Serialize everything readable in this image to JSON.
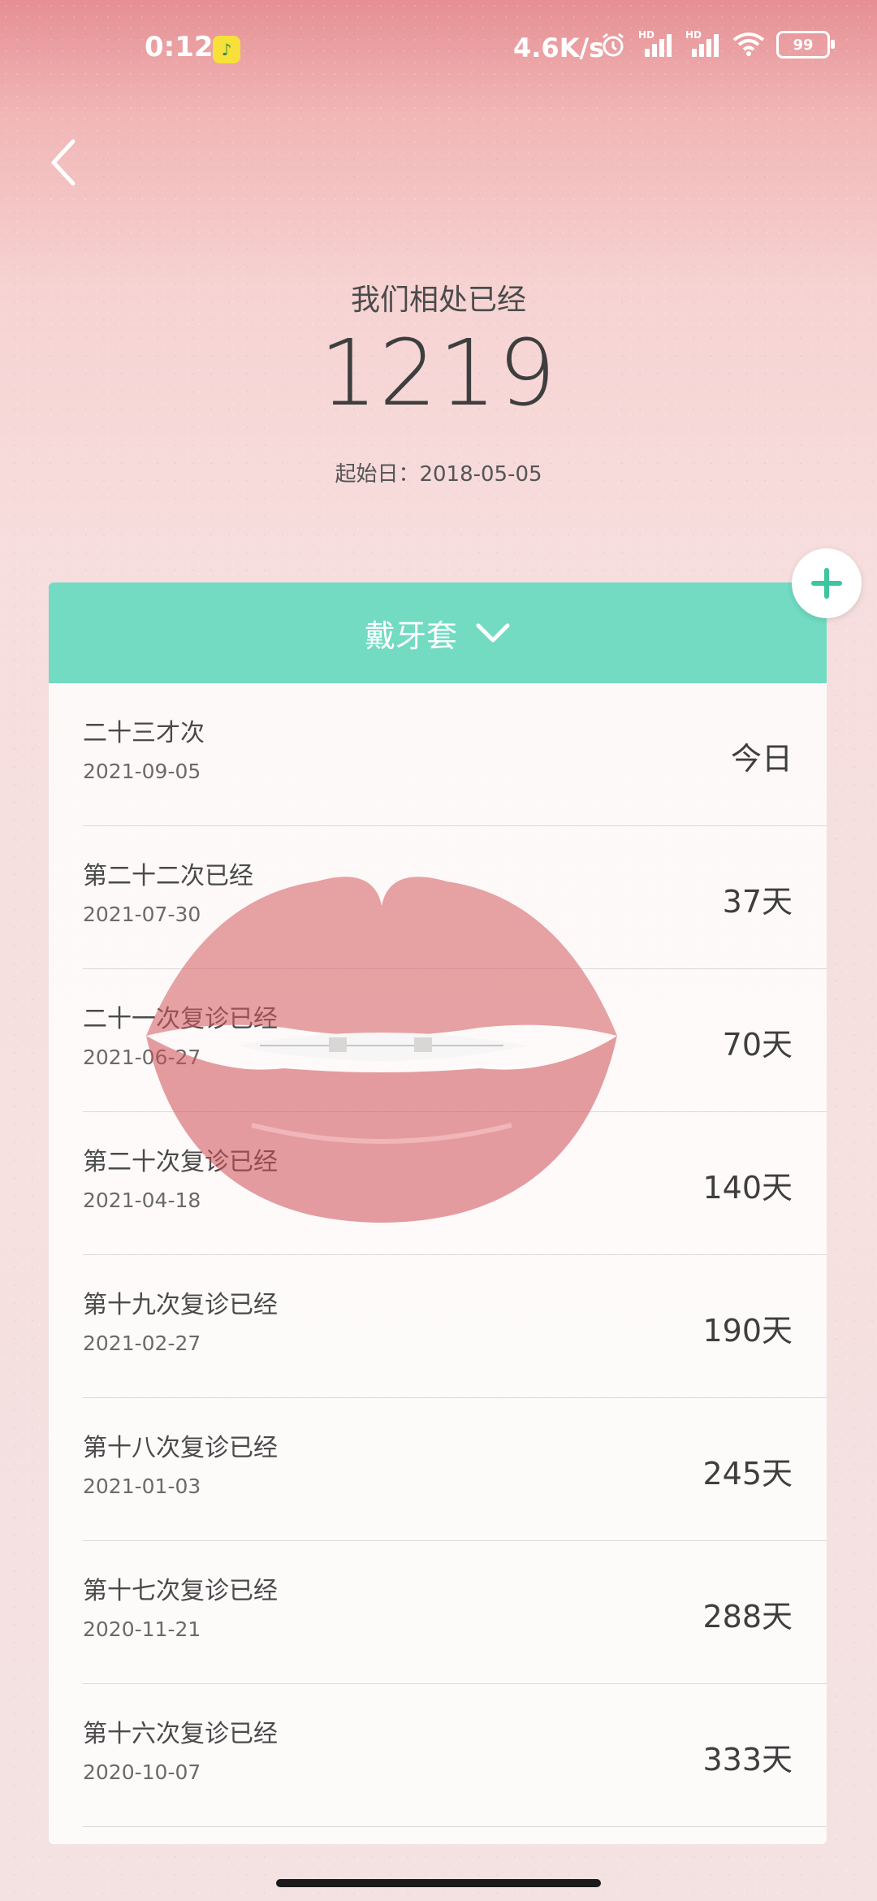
{
  "status_bar": {
    "time": "0:12",
    "net_speed": "4.6K/s",
    "battery": "99",
    "hd1": "HD",
    "hd2": "HD"
  },
  "header": {
    "label": "我们相处已经",
    "days": "1219",
    "start_date": "起始日：2018-05-05"
  },
  "card": {
    "title": "戴牙套"
  },
  "records": [
    {
      "title": "二十三才次",
      "date": "2021-09-05",
      "days": "今日"
    },
    {
      "title": "第二十二次已经",
      "date": "2021-07-30",
      "days": "37天"
    },
    {
      "title": "二十一次复诊已经",
      "date": "2021-06-27",
      "days": "70天"
    },
    {
      "title": "第二十次复诊已经",
      "date": "2021-04-18",
      "days": "140天"
    },
    {
      "title": "第十九次复诊已经",
      "date": "2021-02-27",
      "days": "190天"
    },
    {
      "title": "第十八次复诊已经",
      "date": "2021-01-03",
      "days": "245天"
    },
    {
      "title": "第十七次复诊已经",
      "date": "2020-11-21",
      "days": "288天"
    },
    {
      "title": "第十六次复诊已经",
      "date": "2020-10-07",
      "days": "333天"
    }
  ],
  "colors": {
    "accent": "#72dbc2",
    "plus": "#3cc59f"
  }
}
